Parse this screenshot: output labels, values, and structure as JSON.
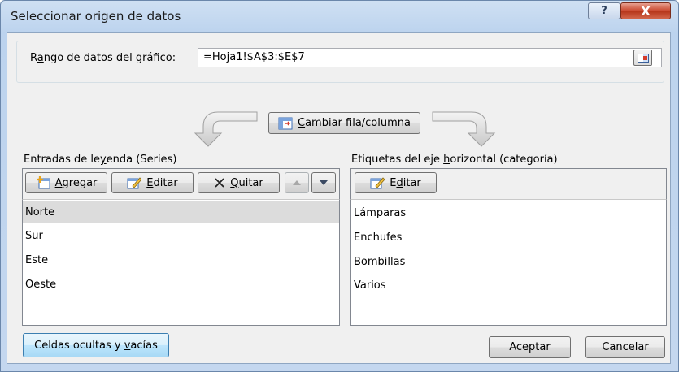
{
  "window": {
    "title": "Seleccionar origen de datos",
    "help_symbol": "?",
    "close_symbol": "X"
  },
  "range": {
    "label_pre": "R",
    "label_u": "a",
    "label_post": "ngo de datos del gráfico:",
    "value": "=Hoja1!$A$3:$E$7"
  },
  "switch": {
    "label_u": "C",
    "label_post": "ambiar fila/columna"
  },
  "legend": {
    "header_pre": "Entradas de le",
    "header_u": "y",
    "header_post": "enda (Series)",
    "add_u": "A",
    "add_post": "gregar",
    "edit_u": "E",
    "edit_post": "ditar",
    "remove_u": "Q",
    "remove_post": "uitar",
    "series": [
      "Norte",
      "Sur",
      "Este",
      "Oeste"
    ]
  },
  "axis": {
    "header_pre": "Etiquetas del eje ",
    "header_u": "h",
    "header_post": "orizontal (categoría)",
    "edit_pre": "E",
    "edit_u": "d",
    "edit_post": "itar",
    "categories": [
      "Lámparas",
      "Enchufes",
      "Bombillas",
      "Varios"
    ]
  },
  "footer": {
    "hidden_pre": "Celdas ocultas y ",
    "hidden_u": "v",
    "hidden_post": "acías",
    "ok": "Aceptar",
    "cancel": "Cancelar"
  },
  "colors": {
    "title_bar": "#bcd3ee",
    "close": "#c9462c",
    "selected_row": "#dcdcdc"
  }
}
